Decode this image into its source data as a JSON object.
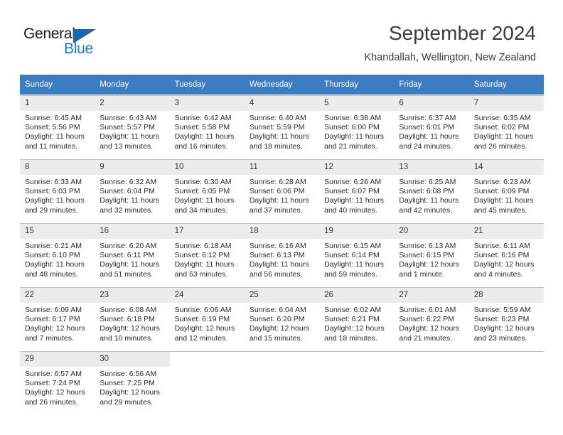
{
  "brand": {
    "name_part1": "General",
    "name_part2": "Blue",
    "triangle_icon": "logo-triangle-icon",
    "accent_color": "#1b7fc4",
    "dark_color": "#1b1b1b"
  },
  "header": {
    "month_title": "September 2024",
    "location": "Khandallah, Wellington, New Zealand"
  },
  "calendar": {
    "header_bg": "#3b7dc0",
    "daynum_bg": "#ececec",
    "weekday_headers": [
      "Sunday",
      "Monday",
      "Tuesday",
      "Wednesday",
      "Thursday",
      "Friday",
      "Saturday"
    ],
    "weeks": [
      [
        {
          "day": "1",
          "sunrise": "Sunrise: 6:45 AM",
          "sunset": "Sunset: 5:56 PM",
          "daylight1": "Daylight: 11 hours",
          "daylight2": "and 11 minutes."
        },
        {
          "day": "2",
          "sunrise": "Sunrise: 6:43 AM",
          "sunset": "Sunset: 5:57 PM",
          "daylight1": "Daylight: 11 hours",
          "daylight2": "and 13 minutes."
        },
        {
          "day": "3",
          "sunrise": "Sunrise: 6:42 AM",
          "sunset": "Sunset: 5:58 PM",
          "daylight1": "Daylight: 11 hours",
          "daylight2": "and 16 minutes."
        },
        {
          "day": "4",
          "sunrise": "Sunrise: 6:40 AM",
          "sunset": "Sunset: 5:59 PM",
          "daylight1": "Daylight: 11 hours",
          "daylight2": "and 18 minutes."
        },
        {
          "day": "5",
          "sunrise": "Sunrise: 6:38 AM",
          "sunset": "Sunset: 6:00 PM",
          "daylight1": "Daylight: 11 hours",
          "daylight2": "and 21 minutes."
        },
        {
          "day": "6",
          "sunrise": "Sunrise: 6:37 AM",
          "sunset": "Sunset: 6:01 PM",
          "daylight1": "Daylight: 11 hours",
          "daylight2": "and 24 minutes."
        },
        {
          "day": "7",
          "sunrise": "Sunrise: 6:35 AM",
          "sunset": "Sunset: 6:02 PM",
          "daylight1": "Daylight: 11 hours",
          "daylight2": "and 26 minutes."
        }
      ],
      [
        {
          "day": "8",
          "sunrise": "Sunrise: 6:33 AM",
          "sunset": "Sunset: 6:03 PM",
          "daylight1": "Daylight: 11 hours",
          "daylight2": "and 29 minutes."
        },
        {
          "day": "9",
          "sunrise": "Sunrise: 6:32 AM",
          "sunset": "Sunset: 6:04 PM",
          "daylight1": "Daylight: 11 hours",
          "daylight2": "and 32 minutes."
        },
        {
          "day": "10",
          "sunrise": "Sunrise: 6:30 AM",
          "sunset": "Sunset: 6:05 PM",
          "daylight1": "Daylight: 11 hours",
          "daylight2": "and 34 minutes."
        },
        {
          "day": "11",
          "sunrise": "Sunrise: 6:28 AM",
          "sunset": "Sunset: 6:06 PM",
          "daylight1": "Daylight: 11 hours",
          "daylight2": "and 37 minutes."
        },
        {
          "day": "12",
          "sunrise": "Sunrise: 6:26 AM",
          "sunset": "Sunset: 6:07 PM",
          "daylight1": "Daylight: 11 hours",
          "daylight2": "and 40 minutes."
        },
        {
          "day": "13",
          "sunrise": "Sunrise: 6:25 AM",
          "sunset": "Sunset: 6:08 PM",
          "daylight1": "Daylight: 11 hours",
          "daylight2": "and 42 minutes."
        },
        {
          "day": "14",
          "sunrise": "Sunrise: 6:23 AM",
          "sunset": "Sunset: 6:09 PM",
          "daylight1": "Daylight: 11 hours",
          "daylight2": "and 45 minutes."
        }
      ],
      [
        {
          "day": "15",
          "sunrise": "Sunrise: 6:21 AM",
          "sunset": "Sunset: 6:10 PM",
          "daylight1": "Daylight: 11 hours",
          "daylight2": "and 48 minutes."
        },
        {
          "day": "16",
          "sunrise": "Sunrise: 6:20 AM",
          "sunset": "Sunset: 6:11 PM",
          "daylight1": "Daylight: 11 hours",
          "daylight2": "and 51 minutes."
        },
        {
          "day": "17",
          "sunrise": "Sunrise: 6:18 AM",
          "sunset": "Sunset: 6:12 PM",
          "daylight1": "Daylight: 11 hours",
          "daylight2": "and 53 minutes."
        },
        {
          "day": "18",
          "sunrise": "Sunrise: 6:16 AM",
          "sunset": "Sunset: 6:13 PM",
          "daylight1": "Daylight: 11 hours",
          "daylight2": "and 56 minutes."
        },
        {
          "day": "19",
          "sunrise": "Sunrise: 6:15 AM",
          "sunset": "Sunset: 6:14 PM",
          "daylight1": "Daylight: 11 hours",
          "daylight2": "and 59 minutes."
        },
        {
          "day": "20",
          "sunrise": "Sunrise: 6:13 AM",
          "sunset": "Sunset: 6:15 PM",
          "daylight1": "Daylight: 12 hours",
          "daylight2": "and 1 minute."
        },
        {
          "day": "21",
          "sunrise": "Sunrise: 6:11 AM",
          "sunset": "Sunset: 6:16 PM",
          "daylight1": "Daylight: 12 hours",
          "daylight2": "and 4 minutes."
        }
      ],
      [
        {
          "day": "22",
          "sunrise": "Sunrise: 6:09 AM",
          "sunset": "Sunset: 6:17 PM",
          "daylight1": "Daylight: 12 hours",
          "daylight2": "and 7 minutes."
        },
        {
          "day": "23",
          "sunrise": "Sunrise: 6:08 AM",
          "sunset": "Sunset: 6:18 PM",
          "daylight1": "Daylight: 12 hours",
          "daylight2": "and 10 minutes."
        },
        {
          "day": "24",
          "sunrise": "Sunrise: 6:06 AM",
          "sunset": "Sunset: 6:19 PM",
          "daylight1": "Daylight: 12 hours",
          "daylight2": "and 12 minutes."
        },
        {
          "day": "25",
          "sunrise": "Sunrise: 6:04 AM",
          "sunset": "Sunset: 6:20 PM",
          "daylight1": "Daylight: 12 hours",
          "daylight2": "and 15 minutes."
        },
        {
          "day": "26",
          "sunrise": "Sunrise: 6:02 AM",
          "sunset": "Sunset: 6:21 PM",
          "daylight1": "Daylight: 12 hours",
          "daylight2": "and 18 minutes."
        },
        {
          "day": "27",
          "sunrise": "Sunrise: 6:01 AM",
          "sunset": "Sunset: 6:22 PM",
          "daylight1": "Daylight: 12 hours",
          "daylight2": "and 21 minutes."
        },
        {
          "day": "28",
          "sunrise": "Sunrise: 5:59 AM",
          "sunset": "Sunset: 6:23 PM",
          "daylight1": "Daylight: 12 hours",
          "daylight2": "and 23 minutes."
        }
      ],
      [
        {
          "day": "29",
          "sunrise": "Sunrise: 6:57 AM",
          "sunset": "Sunset: 7:24 PM",
          "daylight1": "Daylight: 12 hours",
          "daylight2": "and 26 minutes."
        },
        {
          "day": "30",
          "sunrise": "Sunrise: 6:56 AM",
          "sunset": "Sunset: 7:25 PM",
          "daylight1": "Daylight: 12 hours",
          "daylight2": "and 29 minutes."
        },
        {
          "day": "",
          "sunrise": "",
          "sunset": "",
          "daylight1": "",
          "daylight2": ""
        },
        {
          "day": "",
          "sunrise": "",
          "sunset": "",
          "daylight1": "",
          "daylight2": ""
        },
        {
          "day": "",
          "sunrise": "",
          "sunset": "",
          "daylight1": "",
          "daylight2": ""
        },
        {
          "day": "",
          "sunrise": "",
          "sunset": "",
          "daylight1": "",
          "daylight2": ""
        },
        {
          "day": "",
          "sunrise": "",
          "sunset": "",
          "daylight1": "",
          "daylight2": ""
        }
      ]
    ]
  }
}
